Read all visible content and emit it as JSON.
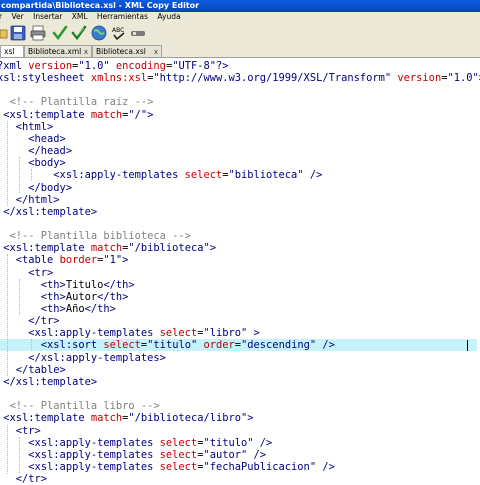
{
  "window": {
    "title": "compartida\\Biblioteca.xsl - XML Copy Editor"
  },
  "menu": [
    "r",
    "Ver",
    "Insertar",
    "XML",
    "Herramientas",
    "Ayuda"
  ],
  "toolbar": {
    "icons": [
      "folder-icon",
      "save-icon",
      "print-icon",
      "check-wellformed-icon",
      "validate-icon",
      "globe-icon",
      "spellcheck-icon",
      "xpath-icon"
    ]
  },
  "tabs": [
    {
      "label": "xsl",
      "close": "x"
    },
    {
      "label": "Biblioteca.xml",
      "close": "x"
    },
    {
      "label": "Biblioteca.xsl",
      "close": "x"
    }
  ],
  "code": [
    [
      [
        "decl",
        "?xml "
      ],
      [
        "attr",
        "version"
      ],
      [
        "txt",
        "="
      ],
      [
        "val",
        "\"1.0\" "
      ],
      [
        "attr",
        "encoding"
      ],
      [
        "txt",
        "="
      ],
      [
        "val",
        "\"UTF-8\""
      ],
      [
        "decl",
        "?>"
      ]
    ],
    [
      [
        "tag",
        "xsl:stylesheet "
      ],
      [
        "attr",
        "xmlns:xsl"
      ],
      [
        "txt",
        "="
      ],
      [
        "val",
        "\"http://www.w3.org/1999/XSL/Transform\" "
      ],
      [
        "attr",
        "version"
      ],
      [
        "txt",
        "="
      ],
      [
        "val",
        "\"1.0\""
      ],
      [
        "tag",
        ">"
      ]
    ],
    [],
    [
      [
        "cmt",
        "  <!-- Plantilla raiz -->"
      ]
    ],
    [
      [
        "tag",
        " <xsl:template "
      ],
      [
        "attr",
        "match"
      ],
      [
        "txt",
        "="
      ],
      [
        "val",
        "\"/\""
      ],
      [
        "tag",
        ">"
      ]
    ],
    [
      [
        "tag",
        "   <html>"
      ]
    ],
    [
      [
        "tag",
        "     <head>"
      ]
    ],
    [
      [
        "tag",
        "     </head>"
      ]
    ],
    [
      [
        "tag",
        "     <body>"
      ]
    ],
    [
      [
        "tag",
        "         <xsl:apply-templates "
      ],
      [
        "attr",
        "select"
      ],
      [
        "txt",
        "="
      ],
      [
        "val",
        "\"biblioteca\" "
      ],
      [
        "tag",
        "/>"
      ]
    ],
    [
      [
        "tag",
        "     </body>"
      ]
    ],
    [
      [
        "tag",
        "   </html>"
      ]
    ],
    [
      [
        "tag",
        " </xsl:template>"
      ]
    ],
    [],
    [
      [
        "cmt",
        "  <!-- Plantilla biblioteca -->"
      ]
    ],
    [
      [
        "tag",
        " <xsl:template "
      ],
      [
        "attr",
        "match"
      ],
      [
        "txt",
        "="
      ],
      [
        "val",
        "\"/biblioteca\""
      ],
      [
        "tag",
        ">"
      ]
    ],
    [
      [
        "tag",
        "   <table "
      ],
      [
        "attr",
        "border"
      ],
      [
        "txt",
        "="
      ],
      [
        "val",
        "\"1\""
      ],
      [
        "tag",
        ">"
      ]
    ],
    [
      [
        "tag",
        "     <tr>"
      ]
    ],
    [
      [
        "tag",
        "       <th>"
      ],
      [
        "txt",
        "Titulo"
      ],
      [
        "tag",
        "</th>"
      ]
    ],
    [
      [
        "tag",
        "       <th>"
      ],
      [
        "txt",
        "Autor"
      ],
      [
        "tag",
        "</th>"
      ]
    ],
    [
      [
        "tag",
        "       <th>"
      ],
      [
        "txt",
        "Año"
      ],
      [
        "tag",
        "</th>"
      ]
    ],
    [
      [
        "tag",
        "     </tr>"
      ]
    ],
    [
      [
        "tag",
        "     <xsl:apply-templates "
      ],
      [
        "attr",
        "select"
      ],
      [
        "txt",
        "="
      ],
      [
        "val",
        "\"libro\" "
      ],
      [
        "tag",
        ">"
      ]
    ],
    [
      [
        "tag",
        "       <xsl:sort "
      ],
      [
        "attr",
        "select"
      ],
      [
        "txt",
        "="
      ],
      [
        "val",
        "\"titulo\" "
      ],
      [
        "attr",
        "order"
      ],
      [
        "txt",
        "="
      ],
      [
        "val",
        "\"descending\" "
      ],
      [
        "tag",
        "/>"
      ]
    ],
    [
      [
        "tag",
        "     </xsl:apply-templates>"
      ]
    ],
    [
      [
        "tag",
        "   </table>"
      ]
    ],
    [
      [
        "tag",
        " </xsl:template>"
      ]
    ],
    [],
    [
      [
        "cmt",
        "  <!-- Plantilla libro -->"
      ]
    ],
    [
      [
        "tag",
        " <xsl:template "
      ],
      [
        "attr",
        "match"
      ],
      [
        "txt",
        "="
      ],
      [
        "val",
        "\"/biblioteca/libro\""
      ],
      [
        "tag",
        ">"
      ]
    ],
    [
      [
        "tag",
        "   <tr>"
      ]
    ],
    [
      [
        "tag",
        "     <xsl:apply-templates "
      ],
      [
        "attr",
        "select"
      ],
      [
        "txt",
        "="
      ],
      [
        "val",
        "\"titulo\" "
      ],
      [
        "tag",
        "/>"
      ]
    ],
    [
      [
        "tag",
        "     <xsl:apply-templates "
      ],
      [
        "attr",
        "select"
      ],
      [
        "txt",
        "="
      ],
      [
        "val",
        "\"autor\" "
      ],
      [
        "tag",
        "/>"
      ]
    ],
    [
      [
        "tag",
        "     <xsl:apply-templates "
      ],
      [
        "attr",
        "select"
      ],
      [
        "txt",
        "="
      ],
      [
        "val",
        "\"fechaPublicacion\" "
      ],
      [
        "tag",
        "/>"
      ]
    ],
    [
      [
        "tag",
        "   </tr>"
      ]
    ]
  ],
  "highlighted_line": 23
}
